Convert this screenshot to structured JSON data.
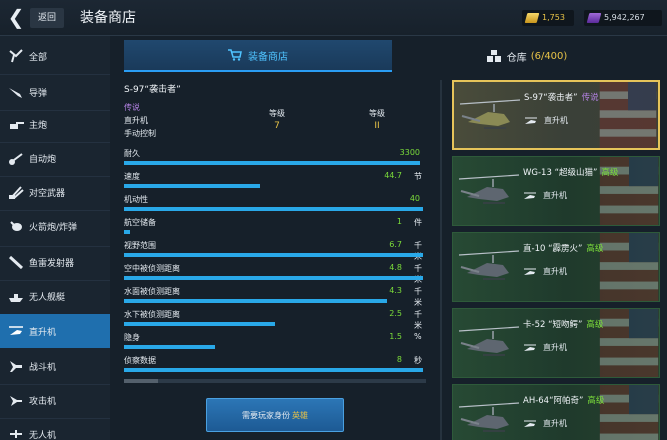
{
  "header": {
    "back_label": "返回",
    "title": "装备商店",
    "gold": "1,753",
    "silver": "5,942,267"
  },
  "sidebar": {
    "items": [
      {
        "label": "全部",
        "icon": "all-icon"
      },
      {
        "label": "导弹",
        "icon": "missile-icon"
      },
      {
        "label": "主炮",
        "icon": "main-gun-icon"
      },
      {
        "label": "自动炮",
        "icon": "auto-cannon-icon"
      },
      {
        "label": "对空武器",
        "icon": "anti-air-icon"
      },
      {
        "label": "火箭炮/炸弹",
        "icon": "rocket-bomb-icon"
      },
      {
        "label": "鱼雷发射器",
        "icon": "torpedo-icon"
      },
      {
        "label": "无人舰艇",
        "icon": "drone-ship-icon"
      },
      {
        "label": "直升机",
        "icon": "helicopter-icon"
      },
      {
        "label": "战斗机",
        "icon": "fighter-icon"
      },
      {
        "label": "攻击机",
        "icon": "attacker-icon"
      },
      {
        "label": "无人机",
        "icon": "drone-icon"
      }
    ],
    "active_index": 8
  },
  "tabs": {
    "shop_label": "装备商店",
    "warehouse_label": "仓库",
    "warehouse_count": "(6/400)"
  },
  "detail": {
    "name": "S-97“袭击者”",
    "rarity": "传说",
    "type": "直升机",
    "control": "手动控制",
    "level_label_1": "等级",
    "level_value_1": "7",
    "level_label_2": "等级",
    "level_value_2": "II",
    "stats": [
      {
        "name": "耐久",
        "value": "3300",
        "unit": "",
        "fill": 0.98
      },
      {
        "name": "速度",
        "value": "44.7",
        "unit": "节",
        "fill": 0.45
      },
      {
        "name": "机动性",
        "value": "40",
        "unit": "",
        "fill": 0.99
      },
      {
        "name": "航空储备",
        "value": "1",
        "unit": "件",
        "fill": 0.0
      },
      {
        "name": "视野范围",
        "value": "6.7",
        "unit": "千米",
        "fill": 0.99
      },
      {
        "name": "空中被侦测距离",
        "value": "4.8",
        "unit": "千米",
        "fill": 0.99
      },
      {
        "name": "水面被侦测距离",
        "value": "4.3",
        "unit": "千米",
        "fill": 0.87
      },
      {
        "name": "水下被侦测距离",
        "value": "2.5",
        "unit": "千米",
        "fill": 0.5
      },
      {
        "name": "隐身",
        "value": "1.5",
        "unit": "%",
        "fill": 0.3
      },
      {
        "name": "侦察数据",
        "value": "8",
        "unit": "秒",
        "fill": 0.99
      }
    ],
    "vip_text": "需要玩家身份",
    "vip_highlight": "英雄"
  },
  "cards": [
    {
      "name": "S-97“袭击者”",
      "rarity": "传说",
      "rarity_color": "#b583e6",
      "type": "直升机"
    },
    {
      "name": "WG-13 “超级山猫”",
      "rarity": "高级",
      "rarity_color": "#7bdc3a",
      "type": "直升机"
    },
    {
      "name": "直-10 “霹雳火”",
      "rarity": "高级",
      "rarity_color": "#7bdc3a",
      "type": "直升机"
    },
    {
      "name": "卡-52 “短吻鳄”",
      "rarity": "高级",
      "rarity_color": "#7bdc3a",
      "type": "直升机"
    },
    {
      "name": "AH-64“阿帕奇”",
      "rarity": "高级",
      "rarity_color": "#7bdc3a",
      "type": "直升机"
    }
  ]
}
